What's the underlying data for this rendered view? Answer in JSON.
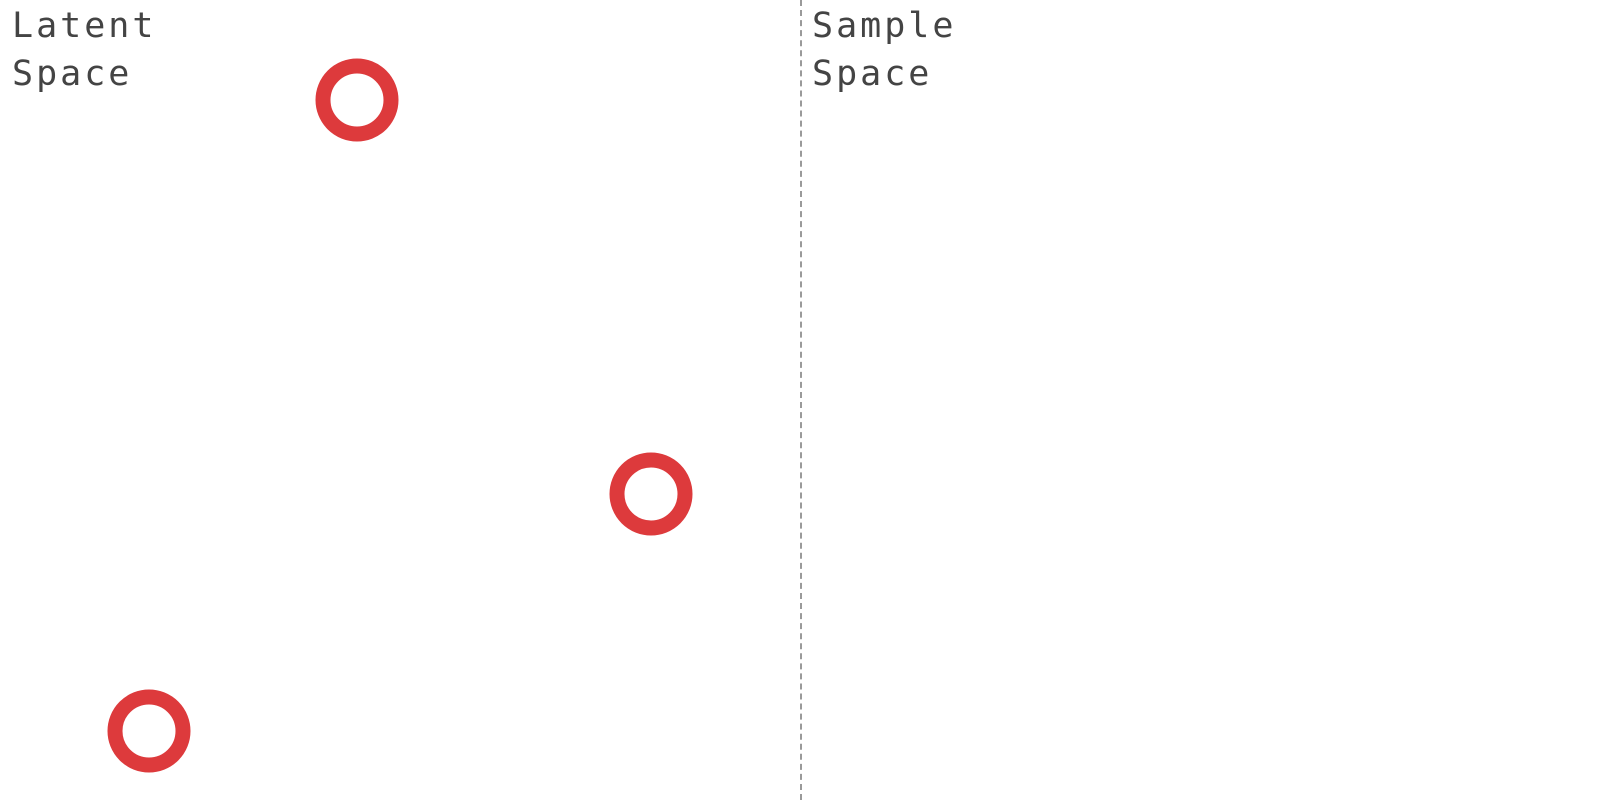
{
  "panels": {
    "latent": {
      "label": "Latent\nSpace"
    },
    "sample": {
      "label": "Sample\nSpace"
    }
  },
  "colors": {
    "point": "#dd3a3c",
    "label": "#444444",
    "divider": "#9a9a9a"
  },
  "points": [
    {
      "id": "point-1"
    },
    {
      "id": "point-2"
    },
    {
      "id": "point-3"
    }
  ]
}
